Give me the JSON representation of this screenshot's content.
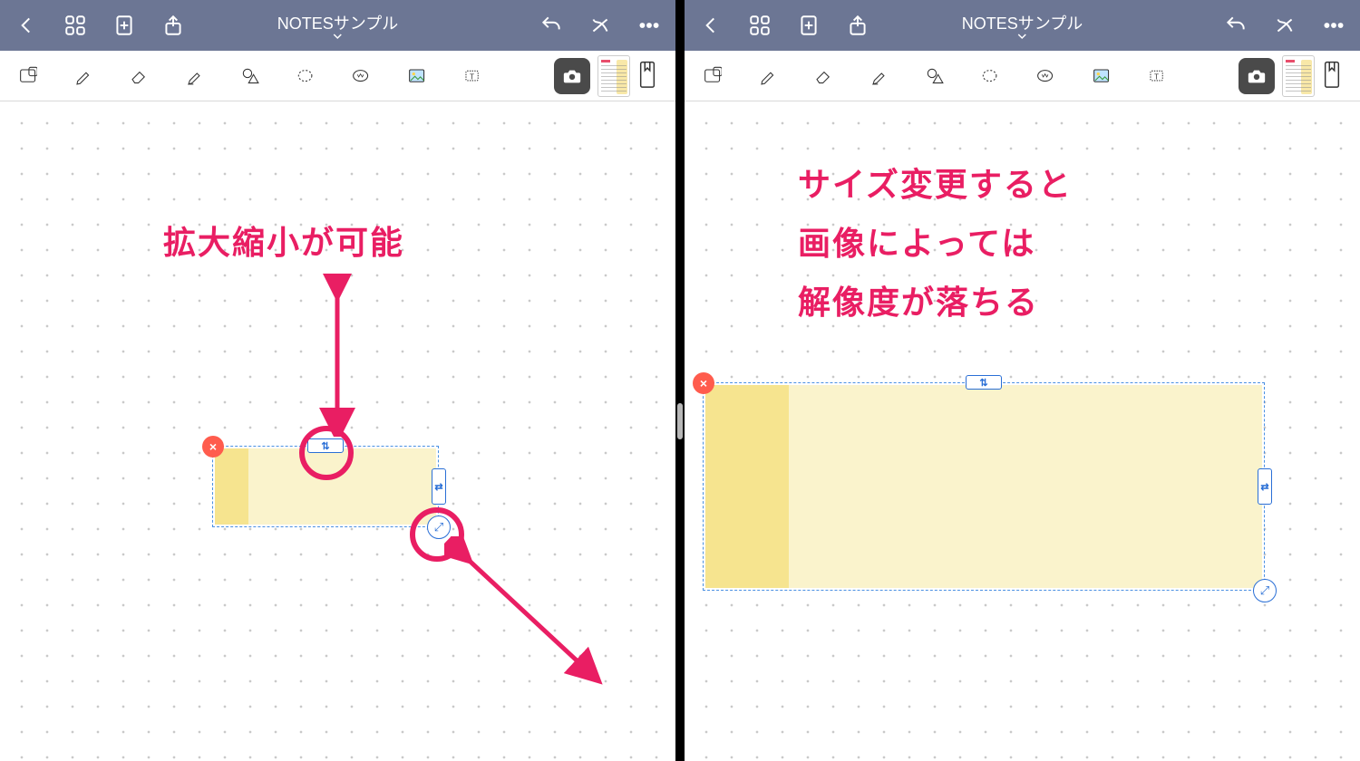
{
  "palette": {
    "accent": "#e91e63",
    "navbar": "#6c7694",
    "selection_border": "#4a90e2",
    "sticker_fill": "#faf3cc",
    "sticker_edge": "#f6e48f",
    "close_button": "#ff5c4d"
  },
  "icons": {
    "back": "chevron-left",
    "grid": "grid-4",
    "add_page": "new-page",
    "share": "share-up",
    "undo": "undo-arrow",
    "more": "ellipsis",
    "close_menu": "x-script",
    "bookmark": "bookmark"
  },
  "toolbar_icons": [
    "read-mode",
    "pen",
    "eraser",
    "highlighter",
    "shapes",
    "lasso",
    "sticker",
    "image",
    "text"
  ],
  "left": {
    "title": "NOTESサンプル",
    "annotation": "拡大縮小が可能",
    "sticker": {
      "size": "small",
      "handles": [
        "top",
        "right",
        "corner"
      ],
      "close": "×",
      "highlight": [
        "top-handle",
        "corner-handle"
      ]
    }
  },
  "right": {
    "title": "NOTESサンプル",
    "annotation": "サイズ変更すると\n画像によっては\n解像度が落ちる",
    "sticker": {
      "size": "large",
      "handles": [
        "top",
        "right",
        "corner"
      ],
      "close": "×"
    }
  }
}
